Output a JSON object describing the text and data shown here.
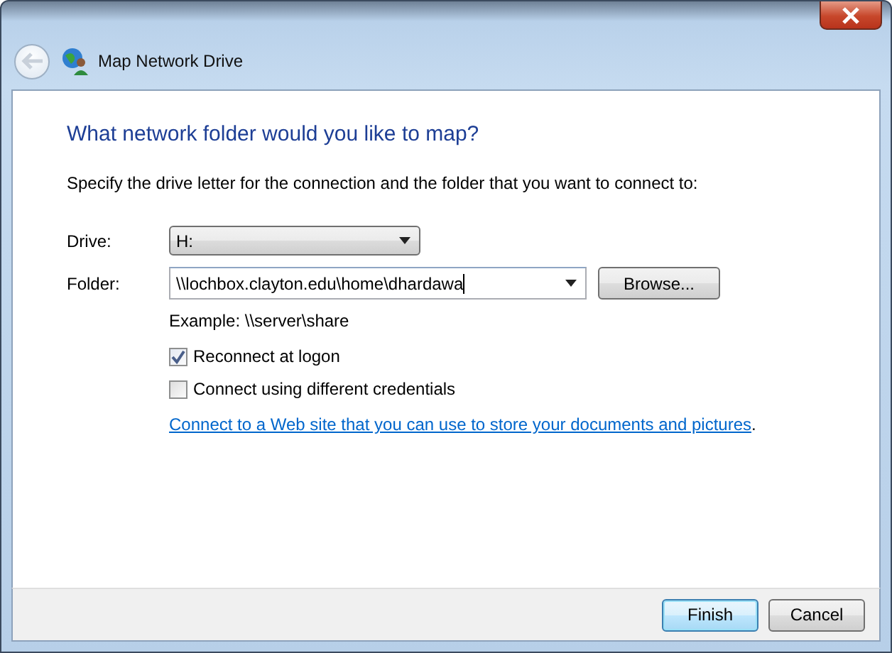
{
  "window": {
    "title": "Map Network Drive"
  },
  "heading": "What network folder would you like to map?",
  "instructions": "Specify the drive letter for the connection and the folder that you want to connect to:",
  "fields": [
    {
      "label": "Drive:",
      "kind": "dropdown",
      "value": "H:"
    },
    {
      "label": "Folder:",
      "kind": "combo",
      "value": "\\\\lochbox.clayton.edu\\home\\dhardawa",
      "button": "Browse..."
    }
  ],
  "example": "Example: \\\\server\\share",
  "options": [
    {
      "label": "Reconnect at logon",
      "checked": true
    },
    {
      "label": "Connect using different credentials",
      "checked": false
    }
  ],
  "link": {
    "text": "Connect to a Web site that you can use to store your documents and pictures",
    "after": "."
  },
  "buttons": [
    {
      "label": "Finish",
      "default": true
    },
    {
      "label": "Cancel",
      "default": false
    }
  ]
}
